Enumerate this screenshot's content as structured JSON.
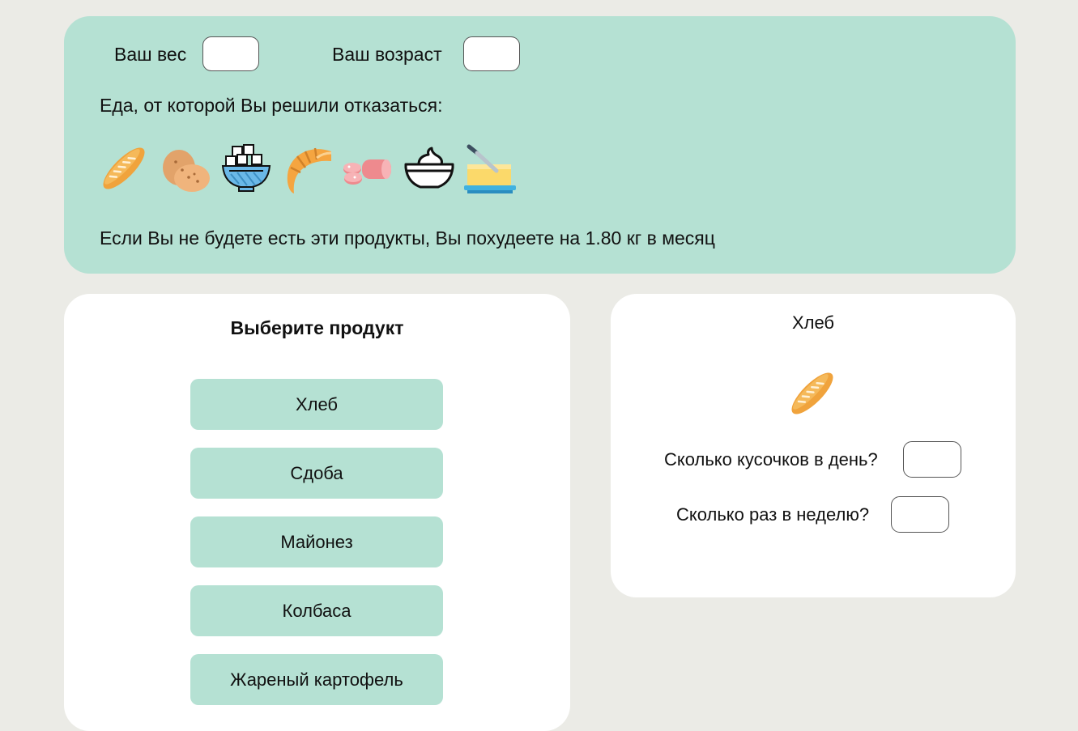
{
  "top": {
    "weight_label": "Ваш вес",
    "weight_value": "",
    "age_label": "Ваш возраст",
    "age_value": "",
    "refuse_label": "Еда, от которой Вы решили отказаться:",
    "refused_icons": [
      "bread-icon",
      "potato-icon",
      "sugar-bowl-icon",
      "croissant-icon",
      "sausage-icon",
      "mayonnaise-icon",
      "butter-icon"
    ],
    "result_text": "Если Вы не будете есть эти продукты, Вы похудеете на 1.80 кг в месяц"
  },
  "product_list": {
    "title": "Выберите продукт",
    "items": [
      "Хлеб",
      "Сдоба",
      "Майонез",
      "Колбаса",
      "Жареный картофель"
    ]
  },
  "detail": {
    "title": "Хлеб",
    "icon": "bread-icon",
    "q1_label": "Сколько кусочков в день?",
    "q1_value": "",
    "q2_label": "Сколько раз в неделю?",
    "q2_value": ""
  },
  "colors": {
    "background": "#ebebe6",
    "panel": "#b5e1d3",
    "card": "#ffffff"
  }
}
